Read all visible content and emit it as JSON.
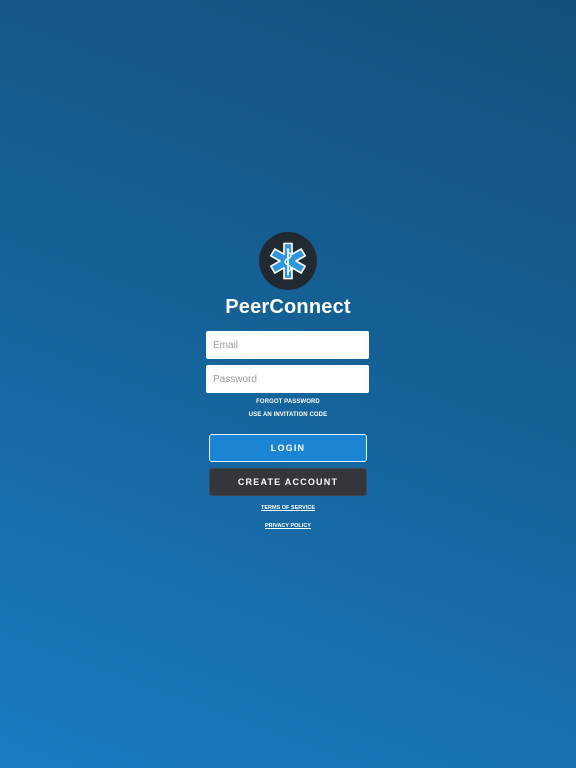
{
  "app": {
    "title": "PeerConnect",
    "logo_icon": "star-of-life-icon",
    "accent_color": "#1b85d3"
  },
  "form": {
    "email_placeholder": "Email",
    "email_value": "",
    "password_placeholder": "Password",
    "password_value": ""
  },
  "links": {
    "forgot_password": "FORGOT PASSWORD",
    "invitation_code": "USE AN INVITATION CODE",
    "terms": "TERMS OF SERVICE",
    "privacy": "PRIVACY POLICY"
  },
  "buttons": {
    "login": "LOGIN",
    "create_account": "CREATE ACCOUNT"
  }
}
